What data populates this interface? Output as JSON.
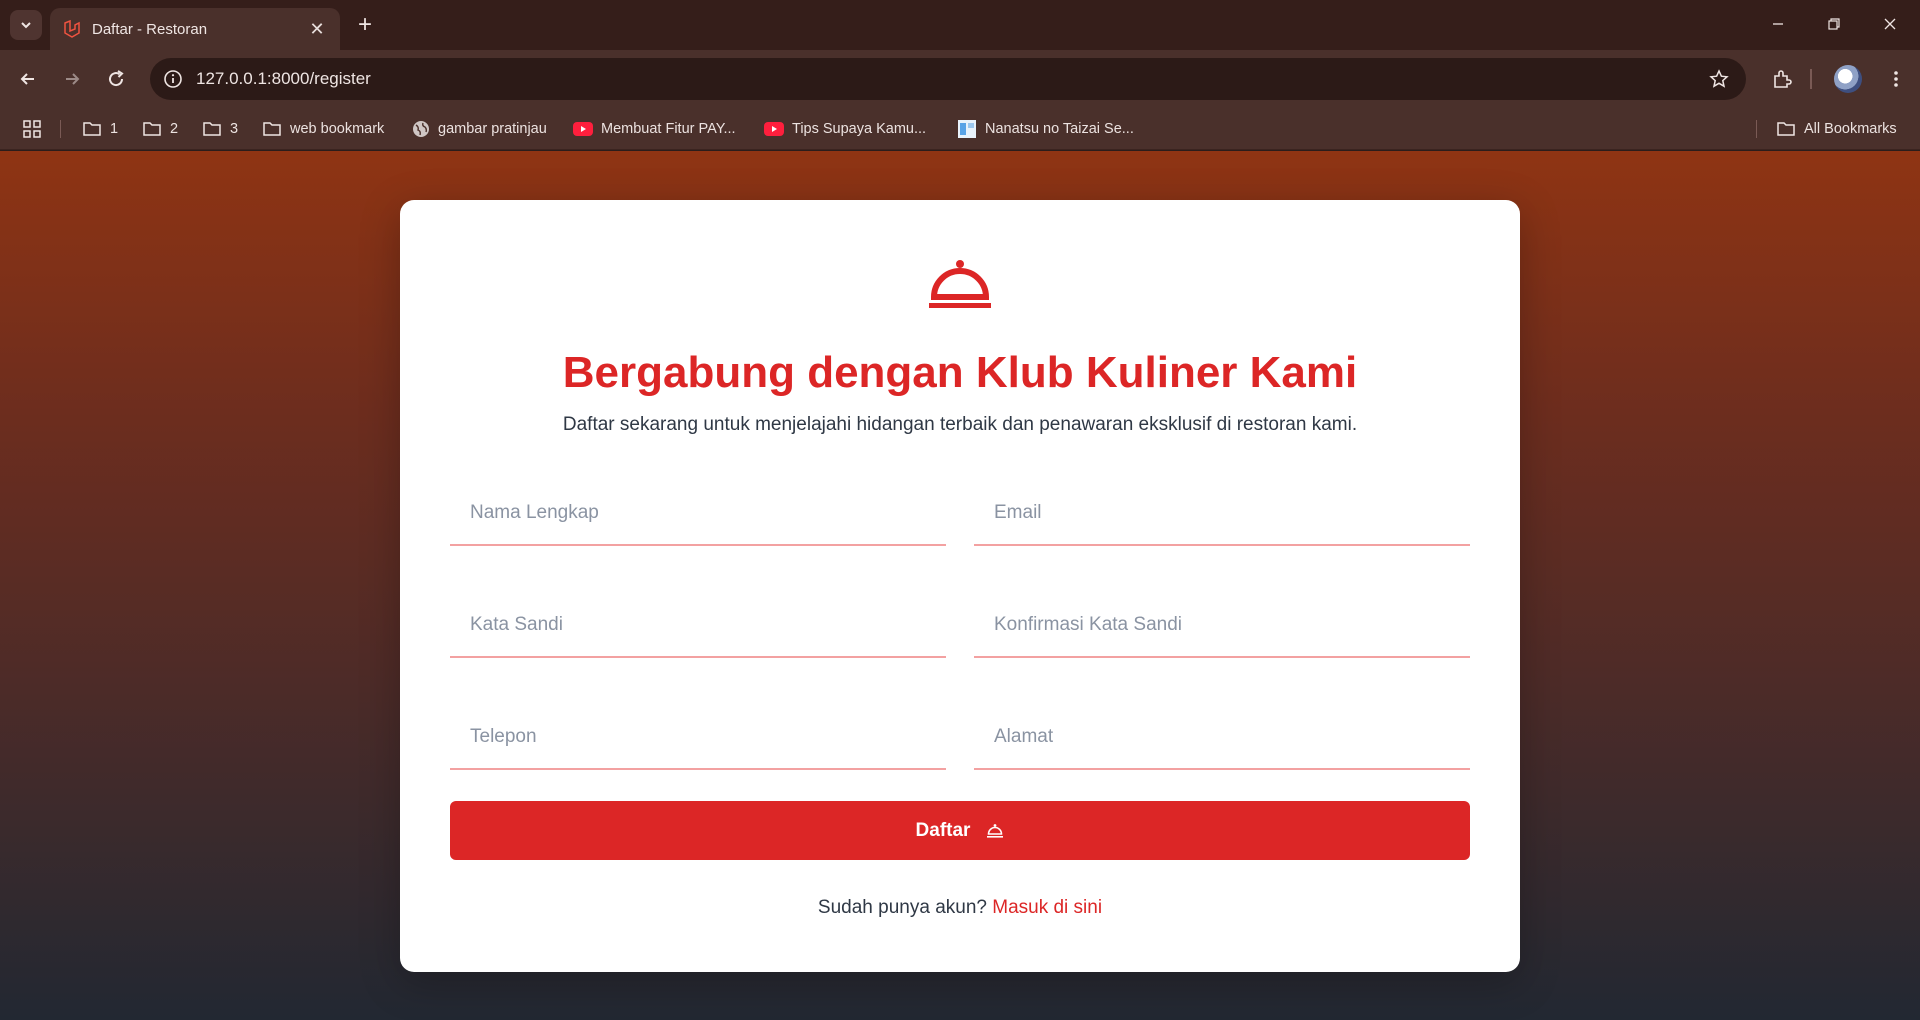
{
  "browser": {
    "tab_title": "Daftar - Restoran",
    "url": "127.0.0.1:8000/register",
    "bookmarks": [
      {
        "label": "1",
        "icon": "folder-icon"
      },
      {
        "label": "2",
        "icon": "folder-icon"
      },
      {
        "label": "3",
        "icon": "folder-icon"
      },
      {
        "label": "web bookmark",
        "icon": "folder-icon"
      },
      {
        "label": "gambar pratinjau",
        "icon": "globe-icon"
      },
      {
        "label": "Membuat Fitur PAY...",
        "icon": "youtube-icon"
      },
      {
        "label": "Tips Supaya Kamu...",
        "icon": "youtube-icon"
      },
      {
        "label": "Nanatsu no Taizai Se...",
        "icon": "site-icon"
      }
    ],
    "all_bookmarks": "All Bookmarks"
  },
  "register": {
    "title": "Bergabung dengan Klub Kuliner Kami",
    "subtitle": "Daftar sekarang untuk menjelajahi hidangan terbaik dan penawaran eksklusif di restoran kami.",
    "fields": {
      "name": "Nama Lengkap",
      "email": "Email",
      "password": "Kata Sandi",
      "password_confirm": "Konfirmasi Kata Sandi",
      "phone": "Telepon",
      "address": "Alamat"
    },
    "submit_label": "Daftar",
    "login_prompt": "Sudah punya akun?",
    "login_link": "Masuk di sini"
  },
  "colors": {
    "accent": "#dc2626",
    "text": "#2f3845",
    "underline": "#f3a1a1"
  }
}
